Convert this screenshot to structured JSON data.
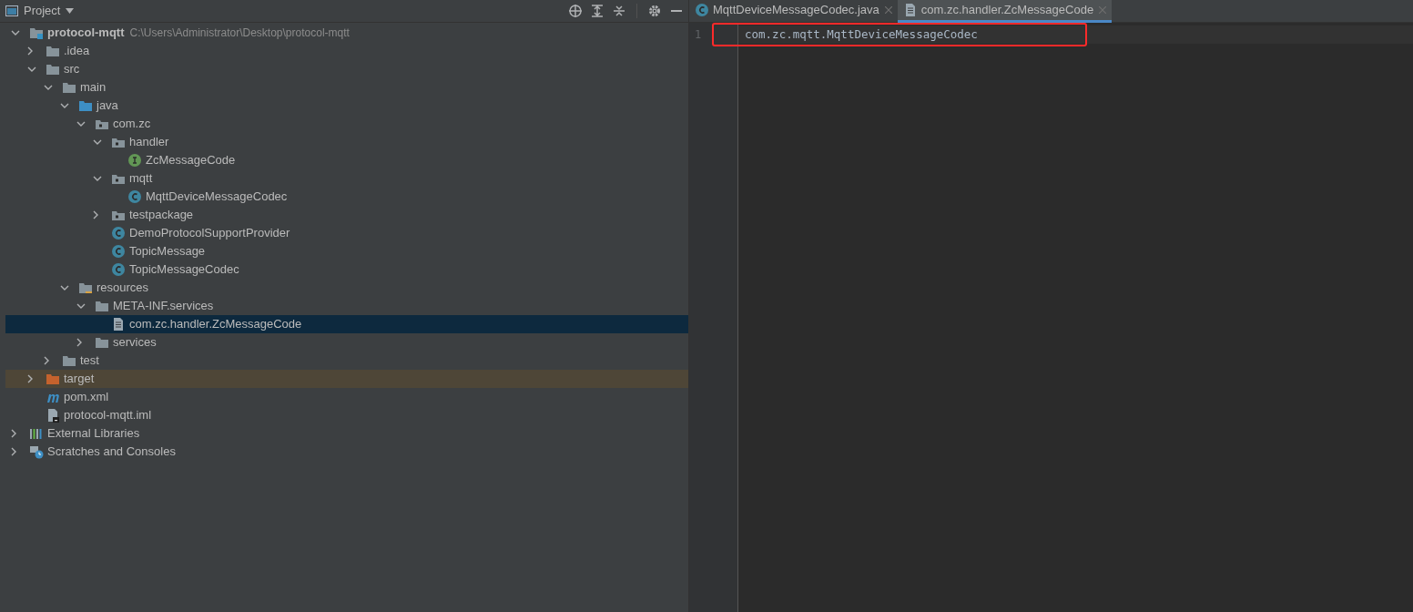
{
  "project_panel": {
    "title": "Project",
    "tree": [
      {
        "label": "protocol-mqtt",
        "kind": "module",
        "path": "C:\\Users\\Administrator\\Desktop\\protocol-mqtt",
        "expanded": true,
        "selected": false,
        "children": [
          {
            "label": ".idea",
            "kind": "folder",
            "expanded": false,
            "selected": false
          },
          {
            "label": "src",
            "kind": "folder",
            "expanded": true,
            "selected": false,
            "children": [
              {
                "label": "main",
                "kind": "folder",
                "expanded": true,
                "selected": false,
                "children": [
                  {
                    "label": "java",
                    "kind": "source-folder",
                    "expanded": true,
                    "selected": false,
                    "children": [
                      {
                        "label": "com.zc",
                        "kind": "package",
                        "expanded": true,
                        "selected": false,
                        "children": [
                          {
                            "label": "handler",
                            "kind": "package",
                            "expanded": true,
                            "selected": false,
                            "children": [
                              {
                                "label": "ZcMessageCode",
                                "kind": "interface",
                                "selected": false
                              }
                            ]
                          },
                          {
                            "label": "mqtt",
                            "kind": "package",
                            "expanded": true,
                            "selected": false,
                            "children": [
                              {
                                "label": "MqttDeviceMessageCodec",
                                "kind": "class",
                                "selected": false
                              }
                            ]
                          },
                          {
                            "label": "testpackage",
                            "kind": "package",
                            "expanded": false,
                            "selected": false
                          },
                          {
                            "label": "DemoProtocolSupportProvider",
                            "kind": "class",
                            "selected": false
                          },
                          {
                            "label": "TopicMessage",
                            "kind": "class",
                            "selected": false
                          },
                          {
                            "label": "TopicMessageCodec",
                            "kind": "class",
                            "selected": false
                          }
                        ]
                      }
                    ]
                  },
                  {
                    "label": "resources",
                    "kind": "resources-folder",
                    "expanded": true,
                    "selected": false,
                    "children": [
                      {
                        "label": "META-INF.services",
                        "kind": "folder",
                        "expanded": true,
                        "selected": false,
                        "children": [
                          {
                            "label": "com.zc.handler.ZcMessageCode",
                            "kind": "file",
                            "selected": true
                          }
                        ]
                      },
                      {
                        "label": "services",
                        "kind": "folder",
                        "expanded": false,
                        "selected": false
                      }
                    ]
                  }
                ]
              },
              {
                "label": "test",
                "kind": "folder",
                "expanded": false,
                "selected": false
              }
            ]
          },
          {
            "label": "target",
            "kind": "excluded-folder",
            "expanded": false,
            "selected": false
          },
          {
            "label": "pom.xml",
            "kind": "maven",
            "selected": false
          },
          {
            "label": "protocol-mqtt.iml",
            "kind": "iml",
            "selected": false
          }
        ]
      },
      {
        "label": "External Libraries",
        "kind": "libraries",
        "expanded": false,
        "selected": false
      },
      {
        "label": "Scratches and Consoles",
        "kind": "scratches",
        "expanded": false,
        "selected": false
      }
    ]
  },
  "editor": {
    "tabs": [
      {
        "label": "MqttDeviceMessageCodec.java",
        "kind": "class",
        "selected": false
      },
      {
        "label": "com.zc.handler.ZcMessageCode",
        "kind": "file",
        "selected": true
      }
    ],
    "lines": [
      {
        "number": "1",
        "text": "com.zc.mqtt.MqttDeviceMessageCodec",
        "highlighted": true
      }
    ]
  }
}
